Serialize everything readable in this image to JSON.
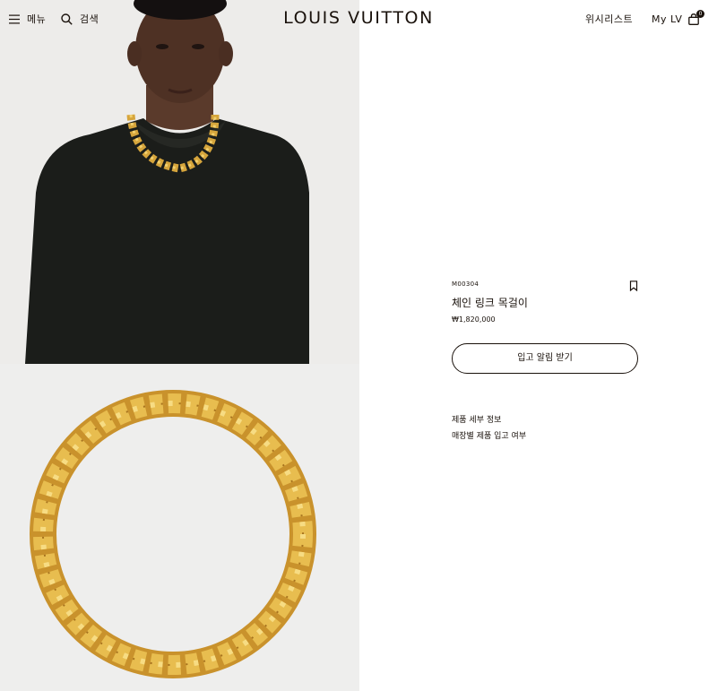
{
  "header": {
    "menu_label": "메뉴",
    "search_label": "검색",
    "logo": "LOUIS VUITTON",
    "wishlist_label": "위시리스트",
    "mylv_label": "My LV",
    "cart_count": "0"
  },
  "icons": {
    "menu": "hamburger-icon",
    "search": "search-icon",
    "cart": "shopping-bag-icon",
    "bookmark": "bookmark-icon"
  },
  "product": {
    "sku": "M00304",
    "name": "체인 링크 목걸이",
    "price": "₩1,820,000",
    "notify_button": "입고 알림 받기",
    "details_link": "제품 세부 정보",
    "store_stock_link": "매장별 제품 입고 여부"
  },
  "colors": {
    "text": "#19110b",
    "gold": "#d9a83a",
    "sweater": "#1b1d1a",
    "background": "#ffffff"
  }
}
